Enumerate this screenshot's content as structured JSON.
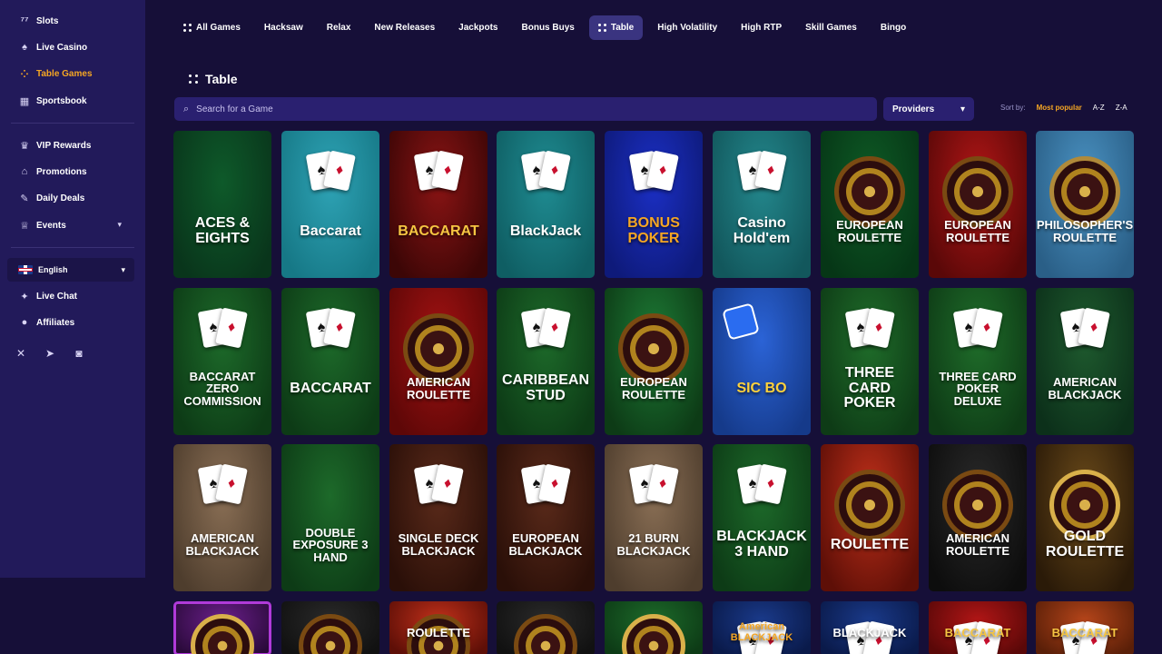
{
  "sidebar": {
    "items": [
      {
        "label": "Slots",
        "icon": "slots-icon",
        "glyph": "⁷⁷"
      },
      {
        "label": "Live Casino",
        "icon": "live-casino-icon",
        "glyph": "♠"
      },
      {
        "label": "Table Games",
        "icon": "table-games-icon",
        "glyph": "⁘",
        "active": true
      },
      {
        "label": "Sportsbook",
        "icon": "sportsbook-icon",
        "glyph": "▦"
      }
    ],
    "items2": [
      {
        "label": "VIP Rewards",
        "icon": "crown-icon",
        "glyph": "♛"
      },
      {
        "label": "Promotions",
        "icon": "gift-icon",
        "glyph": "⌂"
      },
      {
        "label": "Daily Deals",
        "icon": "tag-icon",
        "glyph": "✎"
      },
      {
        "label": "Events",
        "icon": "trophy-icon",
        "glyph": "♕"
      }
    ],
    "language": "English",
    "items3": [
      {
        "label": "Live Chat",
        "icon": "chat-icon",
        "glyph": "✦"
      },
      {
        "label": "Affiliates",
        "icon": "affiliates-icon",
        "glyph": "●"
      }
    ],
    "social": [
      "x-icon",
      "telegram-icon",
      "instagram-icon"
    ]
  },
  "tabs": [
    {
      "label": "All Games"
    },
    {
      "label": "Hacksaw"
    },
    {
      "label": "Relax"
    },
    {
      "label": "New Releases"
    },
    {
      "label": "Jackpots"
    },
    {
      "label": "Bonus Buys"
    },
    {
      "label": "Table",
      "active": true
    },
    {
      "label": "High Volatility"
    },
    {
      "label": "High RTP"
    },
    {
      "label": "Skill Games"
    },
    {
      "label": "Bingo"
    }
  ],
  "section_title": "Table",
  "search": {
    "placeholder": "Search for a Game"
  },
  "providers_label": "Providers",
  "sort": {
    "label": "Sort by:",
    "options": [
      "Most popular",
      "A-Z",
      "Z-A"
    ],
    "active": "Most popular"
  },
  "games": [
    [
      {
        "title": "ACES & EIGHTS",
        "bg": "#0e5a2a",
        "bg2": "#09351b",
        "accent": "#e23b3b"
      },
      {
        "title": "Baccarat",
        "bg": "#2ea3b5",
        "bg2": "#167886",
        "accent": "#e23b9c"
      },
      {
        "title": "BACCARAT",
        "bg": "#8a1414",
        "bg2": "#3c0606",
        "accent": "#f5c542"
      },
      {
        "title": "BlackJack",
        "bg": "#1f8c92",
        "bg2": "#0f5e63",
        "accent": "#ffffff"
      },
      {
        "title": "BONUS POKER",
        "bg": "#1b2fc4",
        "bg2": "#0e1a7a",
        "accent": "#f5a623"
      },
      {
        "title": "Casino Hold'em",
        "bg": "#23878c",
        "bg2": "#12575c",
        "accent": "#ffffff"
      },
      {
        "title": "EUROPEAN ROULETTE",
        "bg": "#0e5a25",
        "bg2": "#063616",
        "accent": "#7a4a12"
      },
      {
        "title": "EUROPEAN ROULETTE",
        "bg": "#b11616",
        "bg2": "#5a0808",
        "accent": "#7a4a12"
      },
      {
        "title": "PHILOSOPHER'S ROULETTE",
        "bg": "#4a92c2",
        "bg2": "#2a5f87",
        "accent": "#b08a3a"
      }
    ],
    [
      {
        "title": "BACCARAT ZERO COMMISSION",
        "bg": "#1d6a2a",
        "bg2": "#0d3b16",
        "accent": "#ffffff"
      },
      {
        "title": "BACCARAT",
        "bg": "#1d6a2a",
        "bg2": "#0d3b16",
        "accent": "#ffffff"
      },
      {
        "title": "AMERICAN ROULETTE",
        "bg": "#a11212",
        "bg2": "#5e0707",
        "accent": "#7a4a12"
      },
      {
        "title": "CARIBBEAN STUD",
        "bg": "#1d6a2a",
        "bg2": "#0d3b16",
        "accent": "#ffffff"
      },
      {
        "title": "EUROPEAN ROULETTE",
        "bg": "#1d7a35",
        "bg2": "#0d3b16",
        "accent": "#7a4a12"
      },
      {
        "title": "SIC BO",
        "bg": "#2b63d6",
        "bg2": "#153a8a",
        "accent": "#ffd23c"
      },
      {
        "title": "THREE CARD POKER",
        "bg": "#1f6d2a",
        "bg2": "#0e3b16",
        "accent": "#ffffff"
      },
      {
        "title": "THREE CARD POKER DELUXE",
        "bg": "#1f6d2a",
        "bg2": "#0e3b16",
        "accent": "#ffffff"
      },
      {
        "title": "AMERICAN BLACKJACK",
        "bg": "#1e5a2e",
        "bg2": "#0c301a",
        "accent": "#ffffff"
      }
    ],
    [
      {
        "title": "AMERICAN BLACKJACK",
        "bg": "#8a6f55",
        "bg2": "#4e3d2d",
        "accent": "#e23b3b"
      },
      {
        "title": "DOUBLE EXPOSURE 3 HAND",
        "bg": "#1d6a2a",
        "bg2": "#0d3b16",
        "accent": "#ffffff"
      },
      {
        "title": "SINGLE DECK BLACKJACK",
        "bg": "#5a2a1a",
        "bg2": "#2a0f08",
        "accent": "#e23b3b"
      },
      {
        "title": "EUROPEAN BLACKJACK",
        "bg": "#5a2a1a",
        "bg2": "#2a0f08",
        "accent": "#e23b3b"
      },
      {
        "title": "21 BURN BLACKJACK",
        "bg": "#8a6f55",
        "bg2": "#4e3d2d",
        "accent": "#e23b3b"
      },
      {
        "title": "BLACKJACK 3 HAND",
        "bg": "#1d6a2a",
        "bg2": "#0d3b16",
        "accent": "#ffffff"
      },
      {
        "title": "ROULETTE",
        "bg": "#c0301a",
        "bg2": "#5e0f07",
        "accent": "#7a4a12"
      },
      {
        "title": "AMERICAN ROULETTE",
        "bg": "#2a2a2a",
        "bg2": "#0d0d0d",
        "accent": "#7a4a12"
      },
      {
        "title": "GOLD ROULETTE",
        "bg": "#6a4a1a",
        "bg2": "#2a1a08",
        "accent": "#d9b04a"
      }
    ],
    [
      {
        "title": "",
        "bg": "#6a1f8a",
        "bg2": "#2a0a3a",
        "accent": "#d9b04a"
      },
      {
        "title": "",
        "bg": "#2a2a2a",
        "bg2": "#111111",
        "accent": "#7a4a12"
      },
      {
        "title": "ROULETTE",
        "bg": "#c0301a",
        "bg2": "#5e0f07",
        "accent": "#7a4a12"
      },
      {
        "title": "",
        "bg": "#2a2a2a",
        "bg2": "#111111",
        "accent": "#7a4a12"
      },
      {
        "title": "",
        "bg": "#1d6a2a",
        "bg2": "#0d3b16",
        "accent": "#d9b04a"
      },
      {
        "title": "American BLACKJACK",
        "bg": "#1a3a8a",
        "bg2": "#0a1a4a",
        "accent": "#f5a623"
      },
      {
        "title": "BLACKJACK",
        "bg": "#1a3a8a",
        "bg2": "#0a1a4a",
        "accent": "#ffffff"
      },
      {
        "title": "BACCARAT",
        "bg": "#b11616",
        "bg2": "#5a0808",
        "accent": "#f5c542"
      },
      {
        "title": "BACCARAT",
        "bg": "#b5451a",
        "bg2": "#5a1f08",
        "accent": "#f5c542"
      }
    ]
  ]
}
